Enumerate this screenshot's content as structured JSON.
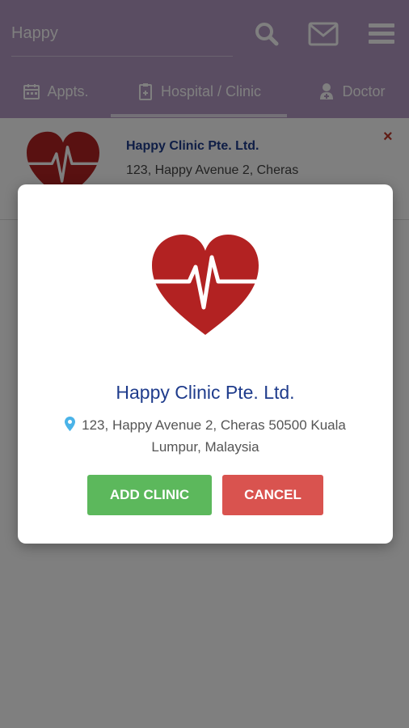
{
  "search": {
    "value": "Happy"
  },
  "header": {
    "icons": [
      "search-icon",
      "mail-icon",
      "menu-icon"
    ],
    "tabs": [
      {
        "label": "Appts.",
        "icon": "calendar-icon"
      },
      {
        "label": "Hospital / Clinic",
        "icon": "clipboard-icon",
        "active": true
      },
      {
        "label": "Doctor",
        "icon": "doctor-icon"
      }
    ]
  },
  "list": {
    "item": {
      "name": "Happy Clinic Pte. Ltd.",
      "address": "123, Happy Avenue 2, Cheras",
      "remove_icon": "×"
    }
  },
  "modal": {
    "name": "Happy Clinic Pte. Ltd.",
    "address": "123, Happy Avenue 2, Cheras 50500 Kuala Lumpur, Malaysia",
    "add_label": "ADD CLINIC",
    "cancel_label": "CANCEL"
  },
  "colors": {
    "header": "#b59bc4",
    "heart": "#b22222",
    "title": "#1f3c8c",
    "add_button": "#5cb85c",
    "cancel_button": "#d9534f",
    "pin": "#4ab3e8"
  }
}
